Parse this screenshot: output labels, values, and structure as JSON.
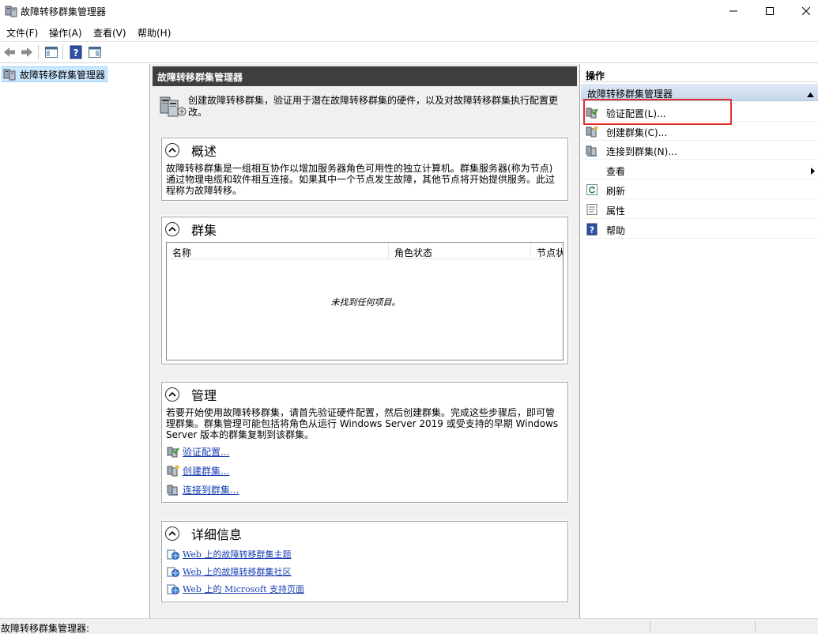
{
  "window": {
    "title": "故障转移群集管理器",
    "app_icon": "cluster-manager-icon"
  },
  "menu": [
    "文件(F)",
    "操作(A)",
    "查看(V)",
    "帮助(H)"
  ],
  "toolbar": {
    "icons": [
      "back-arrow-icon",
      "forward-arrow-icon",
      "show-hide-console-tree-icon",
      "help-icon",
      "show-hide-action-pane-icon"
    ]
  },
  "tree": {
    "root_label": "故障转移群集管理器"
  },
  "center": {
    "header": "故障转移群集管理器",
    "intro": "创建故障转移群集，验证用于潜在故障转移群集的硬件，以及对故障转移群集执行配置更改。",
    "overview": {
      "title": "概述",
      "text": "故障转移群集是一组相互协作以增加服务器角色可用性的独立计算机。群集服务器(称为节点)通过物理电缆和软件相互连接。如果其中一个节点发生故障，其他节点将开始提供服务。此过程称为故障转移。"
    },
    "clusters": {
      "title": "群集",
      "columns": [
        "名称",
        "角色状态",
        "节点状"
      ],
      "empty_message": "未找到任何项目。"
    },
    "management": {
      "title": "管理",
      "text": "若要开始使用故障转移群集，请首先验证硬件配置，然后创建群集。完成这些步骤后，即可管理群集。群集管理可能包括将角色从运行 Windows Server 2019 或受支持的早期 Windows Server 版本的群集复制到该群集。",
      "links": [
        "验证配置...",
        "创建群集...",
        "连接到群集..."
      ]
    },
    "details": {
      "title": "详细信息",
      "links": [
        "Web 上的故障转移群集主题",
        "Web 上的故障转移群集社区",
        "Web 上的 Microsoft 支持页面"
      ]
    }
  },
  "actions": {
    "title": "操作",
    "group": "故障转移群集管理器",
    "items": [
      {
        "label": "验证配置(L)...",
        "icon": "validate-config-icon"
      },
      {
        "label": "创建群集(C)...",
        "icon": "create-cluster-icon"
      },
      {
        "label": "连接到群集(N)...",
        "icon": "connect-cluster-icon"
      },
      {
        "label": "查看",
        "icon": "none"
      },
      {
        "label": "刷新",
        "icon": "refresh-icon"
      },
      {
        "label": "属性",
        "icon": "properties-icon"
      },
      {
        "label": "帮助",
        "icon": "help-icon"
      }
    ]
  },
  "status": {
    "text": "故障转移群集管理器:"
  },
  "colors": {
    "center_header_bg": "#3f3f3f",
    "highlight_border": "#e03030",
    "link": "#1a3fb0",
    "tree_selected_bg": "#cce8ff"
  }
}
